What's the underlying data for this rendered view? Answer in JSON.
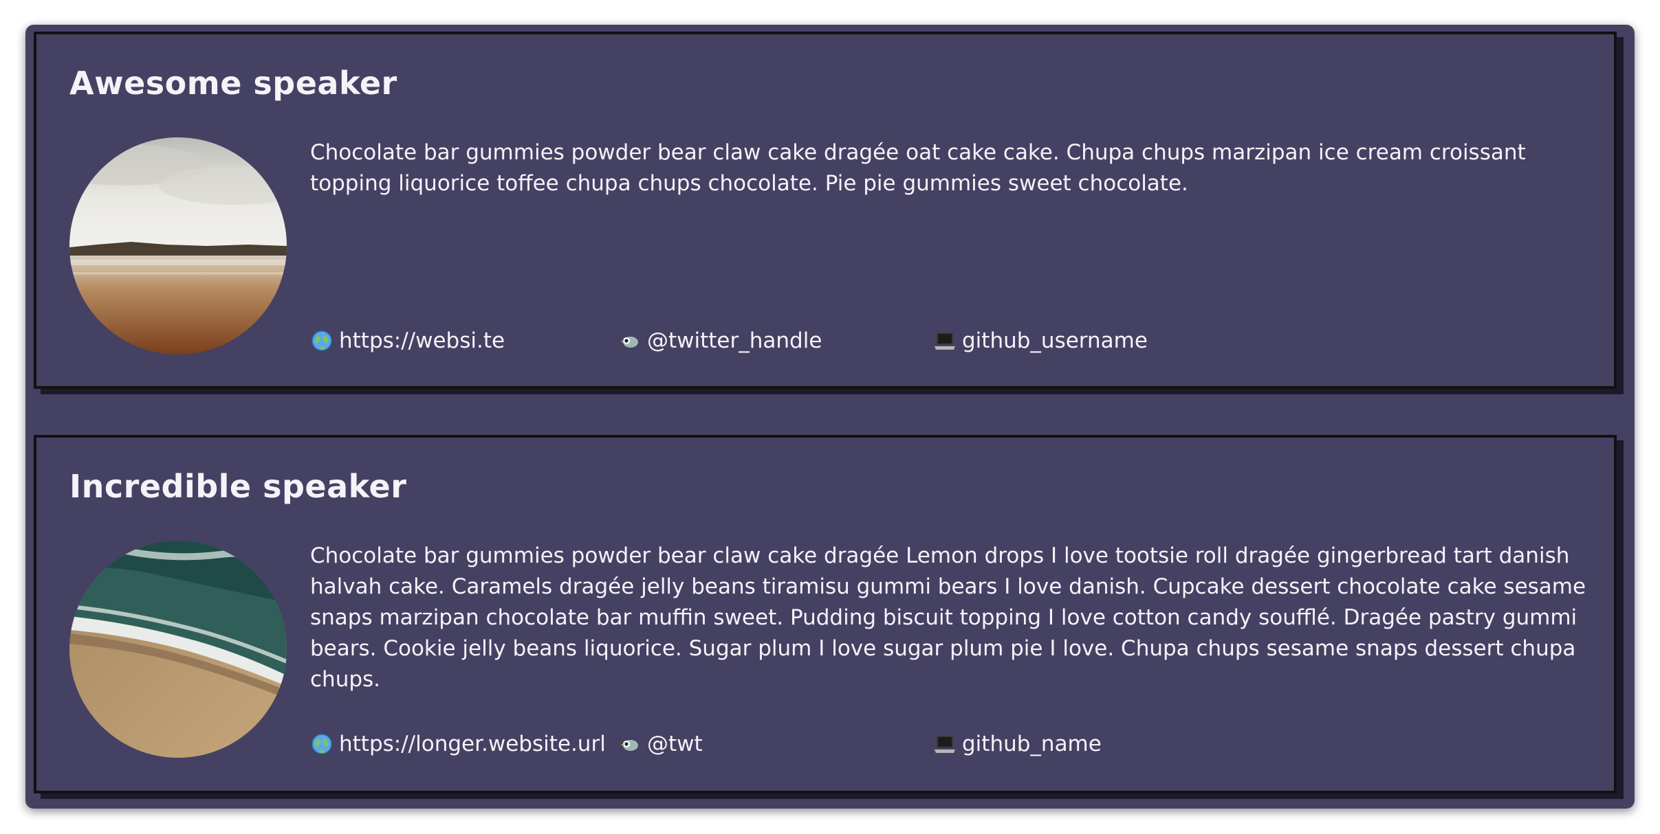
{
  "speakers": [
    {
      "name": "Awesome speaker",
      "bio": "Chocolate bar gummies powder bear claw cake dragée oat cake cake. Chupa chups marzipan ice cream croissant topping liquorice toffee chupa chups chocolate. Pie pie gummies sweet chocolate.",
      "website": "https://websi.te",
      "twitter": "@twitter_handle",
      "github": "github_username",
      "photo_icon": "beach-lake-photo"
    },
    {
      "name": "Incredible speaker",
      "bio": "Chocolate bar gummies powder bear claw cake dragée Lemon drops I love tootsie roll dragée gingerbread tart danish halvah cake. Caramels dragée jelly beans tiramisu gummi bears I love danish. Cupcake dessert chocolate cake sesame snaps marzipan chocolate bar muffin sweet. Pudding biscuit topping I love cotton candy soufflé. Dragée pastry gummi bears. Cookie jelly beans liquorice. Sugar plum I love sugar plum pie I love. Chupa chups sesame snaps dessert chupa chups.",
      "website": "https://longer.website.url",
      "twitter": "@twt",
      "github": "github_name",
      "photo_icon": "ocean-beach-photo"
    }
  ],
  "icons": {
    "website": "globe-icon",
    "twitter": "bird-icon",
    "github": "laptop-icon"
  },
  "colors": {
    "background": "#454163",
    "text": "#f4f3f8",
    "border": "#111111"
  }
}
